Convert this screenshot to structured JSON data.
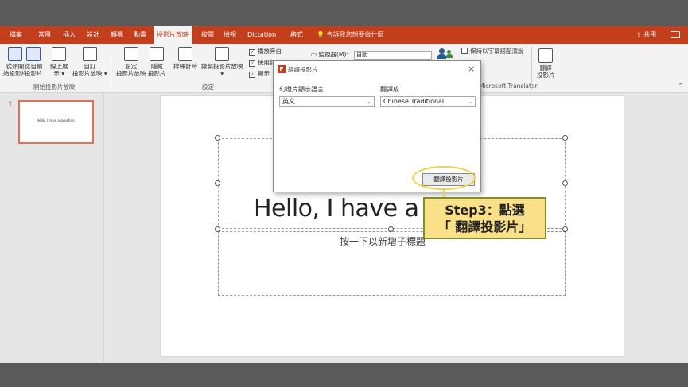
{
  "ribbon_tabs": {
    "file": "檔案",
    "home": "常用",
    "insert": "插入",
    "design": "設計",
    "transitions": "轉場",
    "animations": "動畫",
    "slideshow": "投影片放映",
    "review": "校閱",
    "view": "檢視",
    "dictation": "Dictation",
    "format": "格式",
    "tell_me": "告訴我您想要做什麼",
    "share": "共用"
  },
  "ribbon": {
    "from_beginning": [
      "從頭開",
      "始投影片"
    ],
    "from_current": [
      "從目前",
      "投影片"
    ],
    "present_online": [
      "線上展",
      "示 ▾"
    ],
    "custom_show": [
      "自訂",
      "投影片放映 ▾"
    ],
    "group_start": "開始投影片放映",
    "setup": [
      "設定",
      "投影片放映"
    ],
    "hide_slide": [
      "隱藏",
      "投影片"
    ],
    "rehearse": "排練計時",
    "record": "錄製投影片放映",
    "record_arrow": "▾",
    "play_narrations": "播放旁白",
    "use_timings": "使用計",
    "show_media": "顯示",
    "group_setup": "設定",
    "monitor_label": "監視器(M):",
    "monitor_value": "自動",
    "keep_subtitles": "保持以字幕搭配演說",
    "group_translator": "Microsoft Translator",
    "translate": [
      "翻譯",
      "投影片"
    ]
  },
  "thumbnail": {
    "number": "1",
    "text": "Hello, I have a question."
  },
  "slide": {
    "title": "Hello, I have a question.",
    "subtitle_placeholder": "按一下以新增子標題"
  },
  "dialog": {
    "title": "翻譯投影片",
    "source_label": "幻燈片顯示語言",
    "source_value": "英文",
    "target_label": "翻譯成",
    "target_value": "Chinese Traditional",
    "button_label": "翻譯投影片",
    "close": "×"
  },
  "callout": {
    "line1": "Step3：點選",
    "line2": "「 翻譯投影片」"
  },
  "colors": {
    "accent": "#c43e1c",
    "callout_fill": "#fbe08a",
    "callout_border": "#7d8f2b",
    "ring": "#f5d04a"
  }
}
